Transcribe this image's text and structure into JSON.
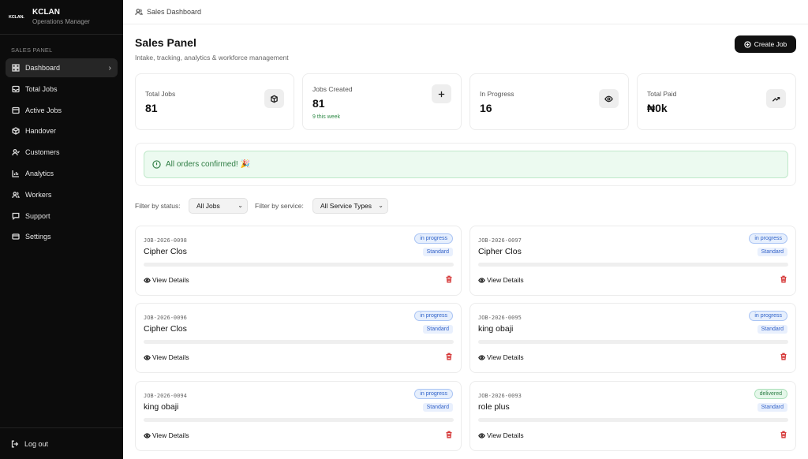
{
  "brand": {
    "logo": "KCLAN.",
    "name": "KCLAN",
    "role": "Operations Manager"
  },
  "sidebar": {
    "section_label": "SALES PANEL",
    "items": [
      {
        "label": "Dashboard",
        "icon": "dashboard-icon",
        "active": true
      },
      {
        "label": "Total Jobs",
        "icon": "inbox-icon"
      },
      {
        "label": "Active Jobs",
        "icon": "activity-icon"
      },
      {
        "label": "Handover",
        "icon": "package-icon"
      },
      {
        "label": "Customers",
        "icon": "users-icon"
      },
      {
        "label": "Analytics",
        "icon": "bar-chart-icon"
      },
      {
        "label": "Workers",
        "icon": "team-icon"
      },
      {
        "label": "Support",
        "icon": "message-icon"
      },
      {
        "label": "Settings",
        "icon": "card-icon"
      }
    ],
    "logout_label": "Log out"
  },
  "topbar": {
    "breadcrumb": "Sales Dashboard"
  },
  "header": {
    "title": "Sales Panel",
    "subtitle": "Intake, tracking, analytics & workforce management",
    "create_label": "Create Job"
  },
  "stats": [
    {
      "label": "Total Jobs",
      "value": "81",
      "icon": "box-icon"
    },
    {
      "label": "Jobs Created",
      "value": "81",
      "note": "9 this week",
      "icon": "plus-icon"
    },
    {
      "label": "In Progress",
      "value": "16",
      "icon": "eye-icon"
    },
    {
      "label": "Total Paid",
      "value": "₦0k",
      "icon": "trending-up-icon"
    }
  ],
  "alert": {
    "text": "All orders confirmed! 🎉"
  },
  "filters": {
    "status_label": "Filter by status:",
    "status_value": "All Jobs",
    "service_label": "Filter by service:",
    "service_value": "All Service Types"
  },
  "jobs": [
    {
      "id": "JOB-2026-0098",
      "name": "Cipher Clos",
      "status": "in progress",
      "type": "Standard",
      "view": "View Details"
    },
    {
      "id": "JOB-2026-0097",
      "name": "Cipher Clos",
      "status": "in progress",
      "type": "Standard",
      "view": "View Details"
    },
    {
      "id": "JOB-2026-0096",
      "name": "Cipher Clos",
      "status": "in progress",
      "type": "Standard",
      "view": "View Details"
    },
    {
      "id": "JOB-2026-0095",
      "name": "king obaji",
      "status": "in progress",
      "type": "Standard",
      "view": "View Details"
    },
    {
      "id": "JOB-2026-0094",
      "name": "king obaji",
      "status": "in progress",
      "type": "Standard",
      "view": "View Details"
    },
    {
      "id": "JOB-2026-0093",
      "name": "role plus",
      "status": "delivered",
      "type": "Standard",
      "view": "View Details"
    }
  ],
  "colors": {
    "sidebar_bg": "#0c0c0c",
    "alert_green": "#2e7d43",
    "in_progress_blue": "#2f62c9",
    "delete_red": "#d63b3b"
  }
}
